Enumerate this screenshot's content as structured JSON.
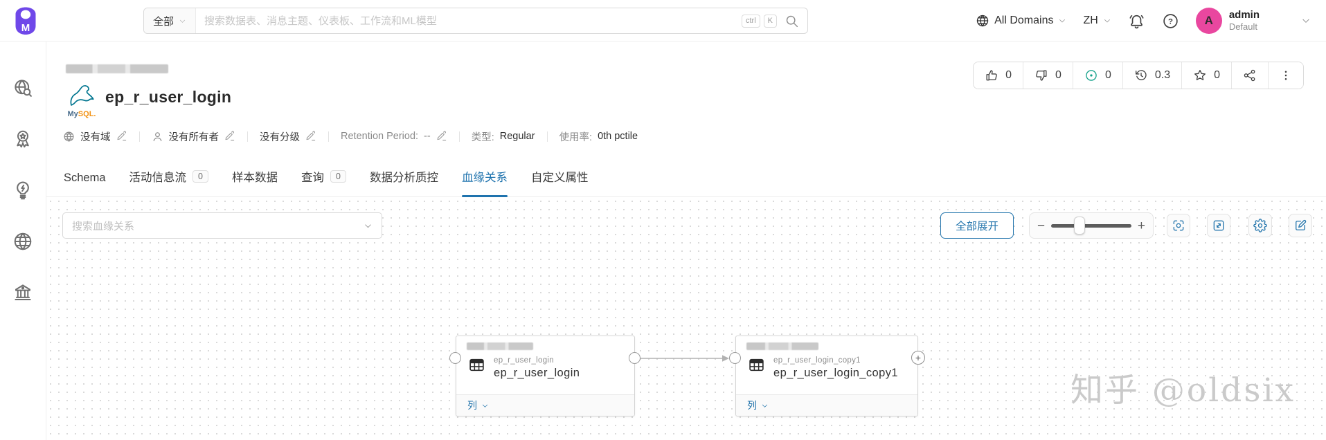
{
  "topbar": {
    "search": {
      "scope": "全部",
      "placeholder": "搜索数据表、消息主题、仪表板、工作流和ML模型",
      "kbd_ctrl": "ctrl",
      "kbd_k": "K"
    },
    "domains_label": "All Domains",
    "language_label": "ZH",
    "user": {
      "initial": "A",
      "name": "admin",
      "role": "Default"
    }
  },
  "sidebar": {
    "items": [
      {
        "icon": "explore-globe-search-icon"
      },
      {
        "icon": "quality-medal-icon"
      },
      {
        "icon": "insights-lightbulb-icon"
      },
      {
        "icon": "domains-globe-icon"
      },
      {
        "icon": "govern-bank-icon"
      }
    ]
  },
  "entity": {
    "title": "ep_r_user_login",
    "service_prefix": "My",
    "service_suffix": "SQL.",
    "stats": {
      "upvotes": "0",
      "downvotes": "0",
      "tasks": "0",
      "version": "0.3",
      "stars": "0"
    },
    "meta": {
      "domain": "没有域",
      "owner": "没有所有者",
      "tier": "没有分级",
      "retention_label": "Retention Period:",
      "retention_value": "--",
      "type_label": "类型:",
      "type_value": "Regular",
      "usage_label": "使用率:",
      "usage_value": "0th pctile"
    }
  },
  "tabs": [
    {
      "label": "Schema"
    },
    {
      "label": "活动信息流",
      "badge": "0"
    },
    {
      "label": "样本数据"
    },
    {
      "label": "查询",
      "badge": "0"
    },
    {
      "label": "数据分析质控"
    },
    {
      "label": "血缘关系"
    },
    {
      "label": "自定义属性"
    }
  ],
  "lineage": {
    "search_placeholder": "搜索血缘关系",
    "expand_all_label": "全部展开",
    "nodes": [
      {
        "type_name": "ep_r_user_login",
        "display_name": "ep_r_user_login",
        "footer_label": "列"
      },
      {
        "type_name": "ep_r_user_login_copy1",
        "display_name": "ep_r_user_login_copy1",
        "footer_label": "列"
      }
    ]
  },
  "watermark": "知乎 @oldsix",
  "colors": {
    "primary_blue": "#1f73ae",
    "avatar_pink": "#e9479f",
    "task_teal": "#14a18a",
    "mysql_blue": "#00758f",
    "mysql_orange": "#f29111",
    "logo_purple": "#6f48e9"
  }
}
